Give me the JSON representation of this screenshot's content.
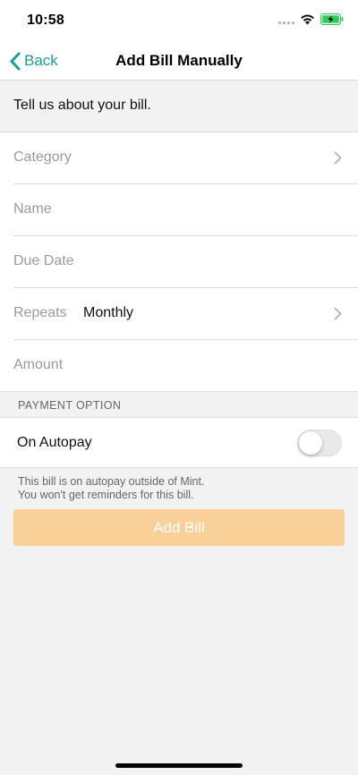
{
  "status_bar": {
    "time": "10:58"
  },
  "nav": {
    "back_label": "Back",
    "title": "Add Bill Manually"
  },
  "intro": "Tell us about your bill.",
  "form": {
    "category_label": "Category",
    "name_label": "Name",
    "due_date_label": "Due Date",
    "repeats_label": "Repeats",
    "repeats_value": "Monthly",
    "amount_label": "Amount"
  },
  "payment": {
    "section_title": "PAYMENT OPTION",
    "autopay_label": "On Autopay",
    "autopay_enabled": false,
    "note_line1": "This bill is on autopay outside of Mint.",
    "note_line2": "You won't get reminders for this bill."
  },
  "actions": {
    "add_bill_label": "Add Bill"
  },
  "colors": {
    "accent": "#1a9e97",
    "button_disabled": "#f9d098",
    "battery": "#34c759"
  },
  "icons": [
    "signal-icon",
    "wifi-icon",
    "battery-charging-icon",
    "chevron-left-icon",
    "chevron-right-icon"
  ]
}
